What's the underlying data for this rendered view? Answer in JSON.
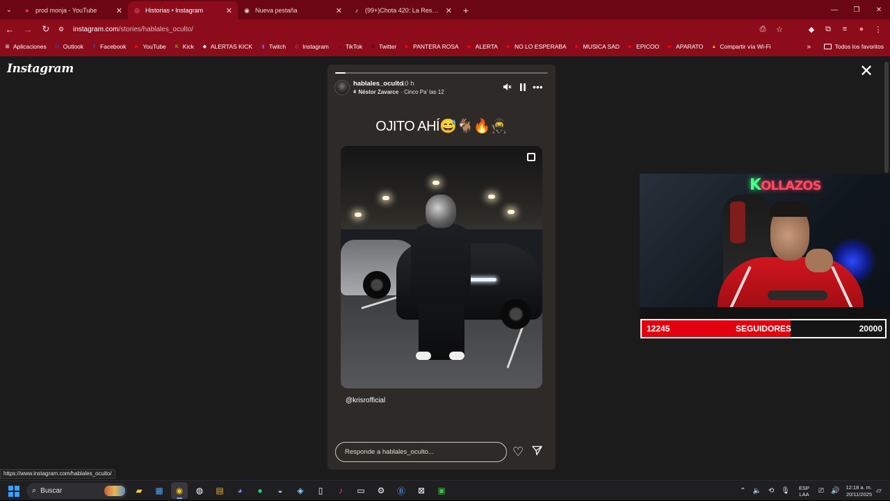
{
  "browser": {
    "tabs": [
      {
        "title": "prod monja - YouTube",
        "icon": "youtube-icon",
        "active": false
      },
      {
        "title": "Historias • Instagram",
        "icon": "instagram-icon",
        "active": true
      },
      {
        "title": "Nueva pestaña",
        "icon": "chrome-icon",
        "active": false
      },
      {
        "title": "(99+)Chota 420: La Respuesta d",
        "icon": "tiktok-icon",
        "active": false
      }
    ],
    "address": {
      "domain": "instagram.com",
      "path": "/stories/hablales_oculto/"
    },
    "bookmarks": [
      {
        "label": "Aplicaciones",
        "icon": "apps-grid-icon",
        "color": "#ffffff"
      },
      {
        "label": "Outlook",
        "icon": "outlook-icon",
        "color": "#0a64c8"
      },
      {
        "label": "Facebook",
        "icon": "facebook-icon",
        "color": "#1877f2"
      },
      {
        "label": "YouTube",
        "icon": "youtube-icon",
        "color": "#ff0000"
      },
      {
        "label": "Kick",
        "icon": "kick-icon",
        "color": "#53fc18"
      },
      {
        "label": "ALERTAS KICK",
        "icon": "diamond-icon",
        "color": "#ffffff"
      },
      {
        "label": "Twitch",
        "icon": "twitch-icon",
        "color": "#9146ff"
      },
      {
        "label": "Instagram",
        "icon": "instagram-icon",
        "color": "#e1306c"
      },
      {
        "label": "TikTok",
        "icon": "tiktok-icon",
        "color": "#111111"
      },
      {
        "label": "Twitter",
        "icon": "x-icon",
        "color": "#111111"
      },
      {
        "label": "PANTERA ROSA",
        "icon": "youtube-icon",
        "color": "#ff0000"
      },
      {
        "label": "ALERTA",
        "icon": "youtube-icon",
        "color": "#ff0000"
      },
      {
        "label": "NO LO ESPERABA",
        "icon": "youtube-icon",
        "color": "#ff0000"
      },
      {
        "label": "MUSICA SAD",
        "icon": "youtube-icon",
        "color": "#ff0000"
      },
      {
        "label": "EPICOO",
        "icon": "youtube-icon",
        "color": "#ff0000"
      },
      {
        "label": "APARATO",
        "icon": "youtube-icon",
        "color": "#ff0000"
      },
      {
        "label": "Compartir vía Wi-Fi",
        "icon": "warning-icon",
        "color": "#f4b400"
      }
    ],
    "all_bookmarks": "Todos los favoritos",
    "status_url": "https://www.instagram.com/hablales_oculto/"
  },
  "instagram": {
    "logo": "Instagram",
    "story": {
      "username": "hablales_oculto",
      "time": "10 h",
      "music_artist": "Néstor Zavarce",
      "music_song": "· Cinco Pa' las 12",
      "caption": "OJITO AHÍ",
      "caption_emoji": "😅🐐🔥🥷",
      "mention": "@krisrofficial",
      "reply_placeholder": "Responde a hablales_oculto...",
      "progress_fraction": 0.05
    }
  },
  "stream": {
    "cam_sign": {
      "k": "K",
      "rest": "OLLAZOS"
    },
    "followers": {
      "current": "12245",
      "label": "SEGUIDORES",
      "goal": "20000",
      "fill_fraction": 0.6122
    }
  },
  "taskbar": {
    "search": "Buscar",
    "language": "ESP",
    "language_sub": "LAA",
    "time": "12:18 a. m.",
    "date": "20/11/2025"
  },
  "colors": {
    "chrome_accent": "#8d0c1c",
    "followers_bar": "#e3000f"
  }
}
